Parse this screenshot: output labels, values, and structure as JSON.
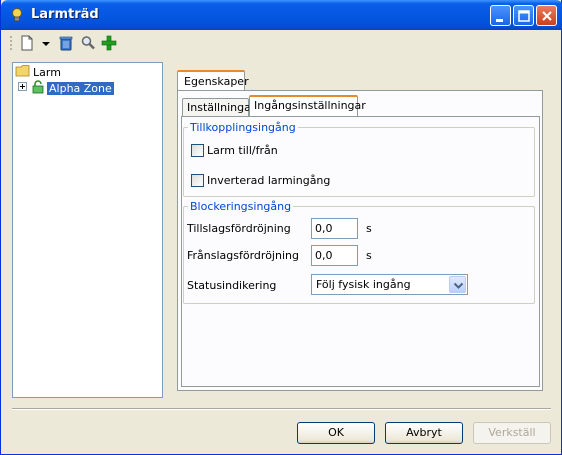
{
  "window": {
    "title": "Larmträd"
  },
  "toolbar": {
    "icons": [
      "new-doc-icon",
      "dropdown-arrow-icon",
      "recycle-bin-icon",
      "magnifier-icon",
      "add-plus-icon"
    ]
  },
  "tree": {
    "root_label": "Larm",
    "child_label": "Alpha Zone"
  },
  "tabs": {
    "outer": "Egenskaper",
    "inner": [
      "Inställningar",
      "Ingångsinställningar"
    ]
  },
  "group1": {
    "title": "Tillkopplingsingång",
    "checkbox1": "Larm till/från",
    "checkbox2": "Inverterad larmingång"
  },
  "group2": {
    "title": "Blockeringsingång",
    "delay_on_label": "Tillslagsfördröjning",
    "delay_on_value": "0,0",
    "delay_on_unit": "s",
    "delay_off_label": "Frånslagsfördröjning",
    "delay_off_value": "0,0",
    "delay_off_unit": "s",
    "status_label": "Statusindikering",
    "status_value": "Följ fysisk ingång"
  },
  "buttons": {
    "ok": "OK",
    "cancel": "Avbryt",
    "apply": "Verkställ"
  },
  "colors": {
    "titlebar": "#0556e0",
    "selection": "#316ac5",
    "group_title": "#0046d5",
    "tab_accent": "#e68b2c"
  }
}
